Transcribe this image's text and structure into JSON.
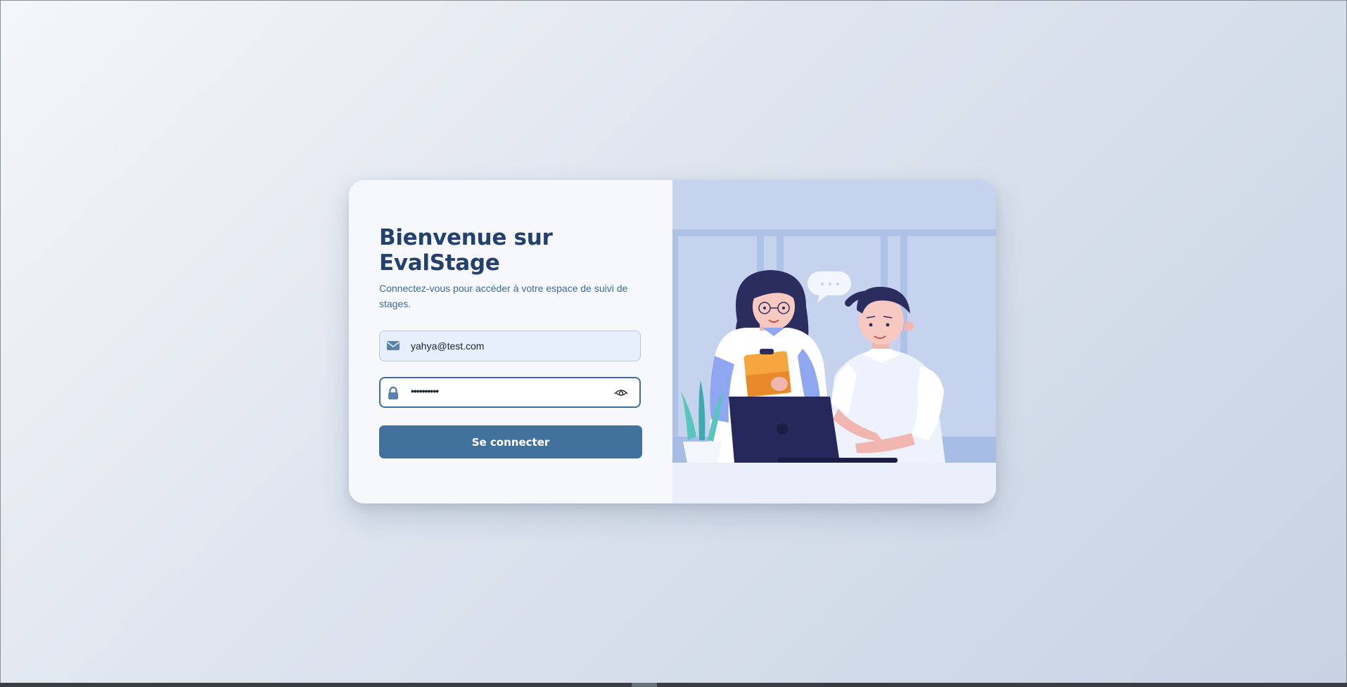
{
  "login": {
    "title": "Bienvenue sur EvalStage",
    "subtitle": "Connectez-vous pour accéder à votre espace de suivi de stages.",
    "email": {
      "value": "yahya@test.com",
      "icon": "envelope-icon"
    },
    "password": {
      "value": "••••••••••",
      "icon": "lock-icon",
      "toggle_icon": "eye-icon"
    },
    "submit_label": "Se connecter"
  },
  "illustration": {
    "description_icon": "two-people-working-illustration",
    "speech_bubble_text": "• • •"
  },
  "colors": {
    "title": "#22416e",
    "subtitle": "#3d6a9a",
    "accent": "#41729e",
    "illustration_bg": "#c6d3ee"
  }
}
